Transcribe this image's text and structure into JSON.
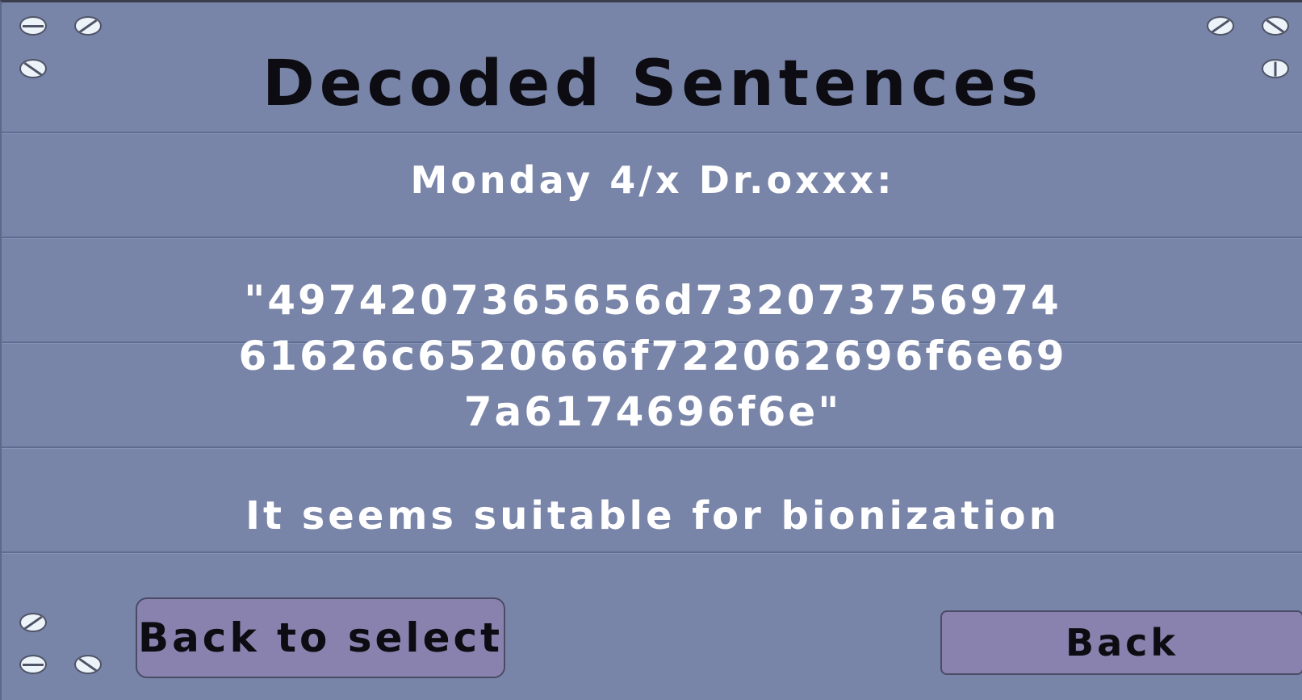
{
  "title": "Decoded Sentences",
  "entry_header": "Monday 4/x Dr.oxxx:",
  "encoded_lines": [
    "\"4974207365656d732073756974",
    "61626c6520666f722062696f6e69",
    "7a6174696f6e\""
  ],
  "decoded_text": "It seems suitable for bionization",
  "buttons": {
    "back_to_select": "Back to select",
    "back": "Back"
  },
  "colors": {
    "panel_background": "#7884a8",
    "button_fill": "#8a82ae",
    "title_text": "#0c0c12",
    "body_text": "#ffffff"
  },
  "icons": [
    "screw-icon"
  ]
}
